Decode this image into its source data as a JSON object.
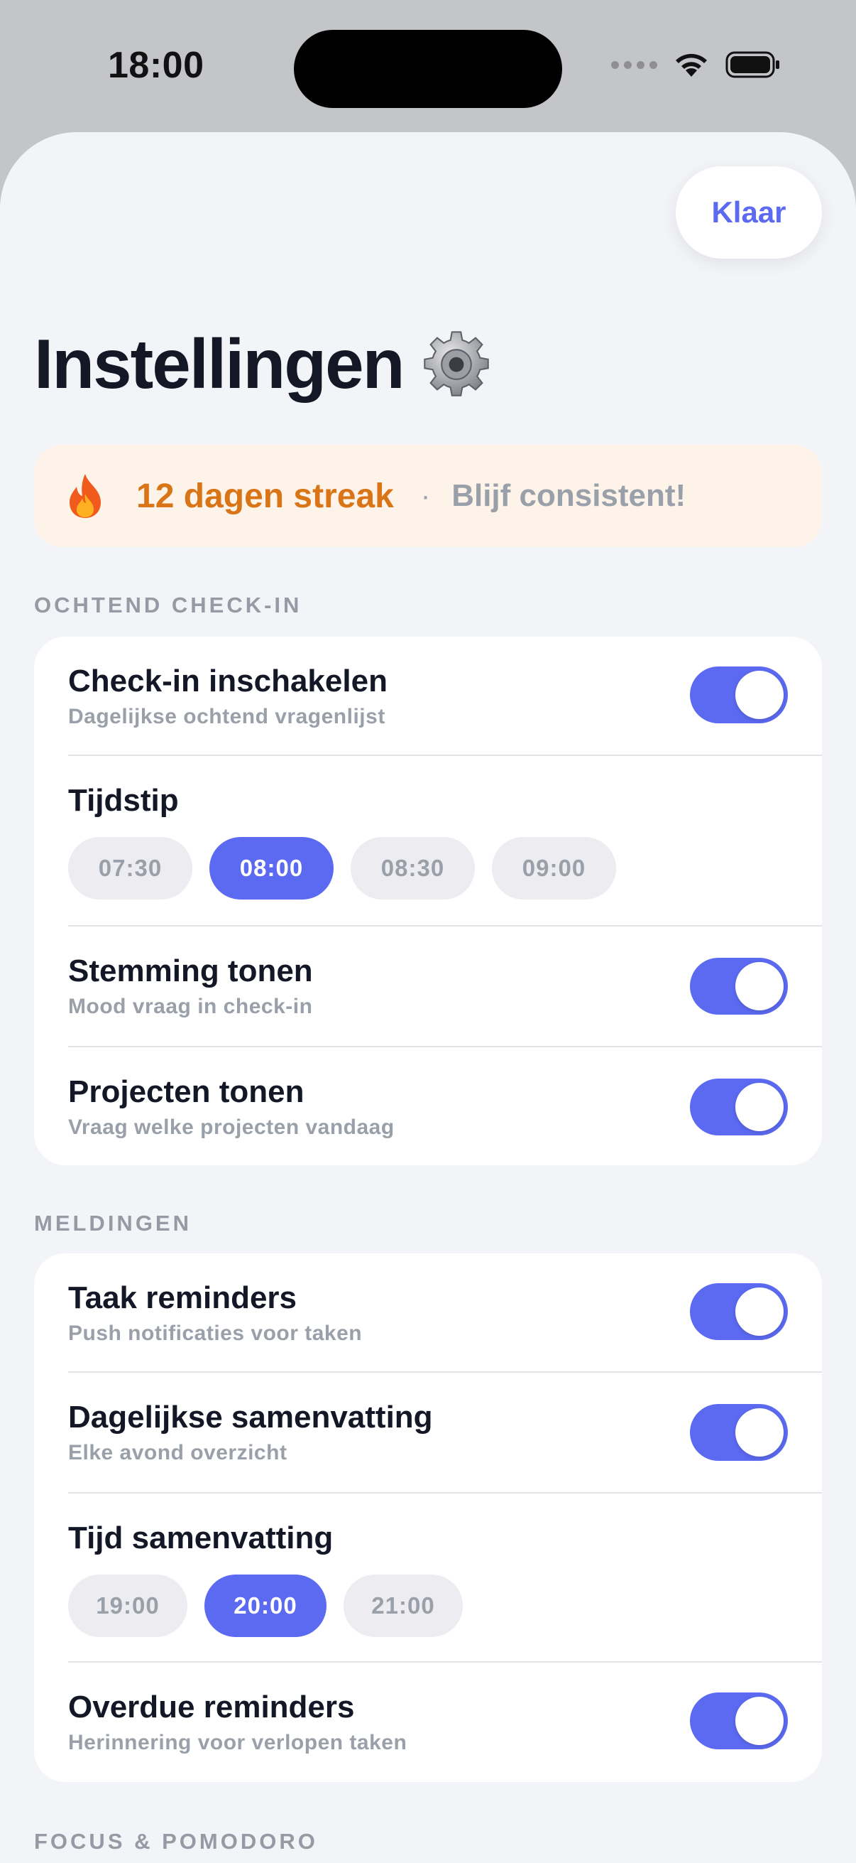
{
  "status": {
    "time": "18:00"
  },
  "header": {
    "done_label": "Klaar",
    "title": "Instellingen"
  },
  "streak": {
    "label": "12 dagen streak",
    "separator": "·",
    "subtitle": "Blijf consistent!"
  },
  "sections": {
    "checkin": {
      "header": "OCHTEND CHECK-IN",
      "enable": {
        "title": "Check-in inschakelen",
        "subtitle": "Dagelijkse ochtend vragenlijst",
        "on": true
      },
      "time": {
        "title": "Tijdstip",
        "options": [
          "07:30",
          "08:00",
          "08:30",
          "09:00"
        ],
        "selected": "08:00"
      },
      "mood": {
        "title": "Stemming tonen",
        "subtitle": "Mood vraag in check-in",
        "on": true
      },
      "projects": {
        "title": "Projecten tonen",
        "subtitle": "Vraag welke projecten vandaag",
        "on": true
      }
    },
    "notifications": {
      "header": "MELDINGEN",
      "task_reminders": {
        "title": "Taak reminders",
        "subtitle": "Push notificaties voor taken",
        "on": true
      },
      "daily_summary": {
        "title": "Dagelijkse samenvatting",
        "subtitle": "Elke avond overzicht",
        "on": true
      },
      "summary_time": {
        "title": "Tijd samenvatting",
        "options": [
          "19:00",
          "20:00",
          "21:00"
        ],
        "selected": "20:00"
      },
      "overdue": {
        "title": "Overdue reminders",
        "subtitle": "Herinnering voor verlopen taken",
        "on": true
      }
    },
    "focus": {
      "header": "FOCUS & POMODORO"
    }
  },
  "colors": {
    "accent": "#5b6af0",
    "streak": "#d97417",
    "background": "#f3f4f8"
  },
  "icons": {
    "title_icon": "gear-icon",
    "streak_icon": "flame-icon"
  }
}
